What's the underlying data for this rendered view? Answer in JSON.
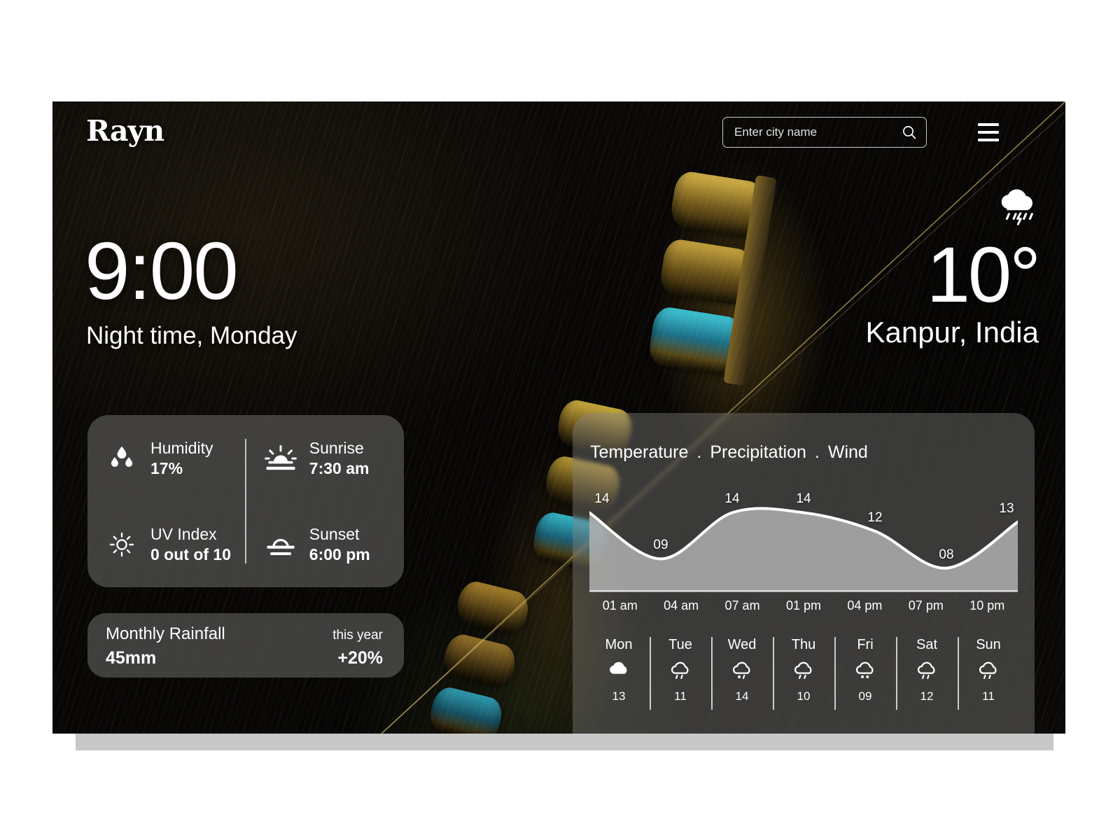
{
  "app": {
    "logo": "Rayn"
  },
  "topbar": {
    "search_placeholder": "Enter city name",
    "search_value": "",
    "search_icon": "search-icon",
    "menu_icon": "hamburger-menu-icon"
  },
  "hero": {
    "time": "9:00",
    "subtitle": "Night time, Monday",
    "temperature": "10°",
    "location": "Kanpur, India",
    "condition_icon": "thunderstorm-rain-cloud-icon"
  },
  "stats": {
    "humidity": {
      "label": "Humidity",
      "value": "17%",
      "icon": "water-drops-icon"
    },
    "uv_index": {
      "label": "UV Index",
      "value": "0 out of 10",
      "icon": "sun-icon"
    },
    "sunrise": {
      "label": "Sunrise",
      "value": "7:30 am",
      "icon": "sunrise-icon"
    },
    "sunset": {
      "label": "Sunset",
      "value": "6:00 pm",
      "icon": "sunset-icon"
    }
  },
  "rainfall": {
    "title": "Monthly Rainfall",
    "value": "45mm",
    "note": "this year",
    "delta": "+20%"
  },
  "forecast": {
    "tabs": [
      {
        "label": "Temperature",
        "active": true
      },
      {
        "label": "Precipitation",
        "active": false
      },
      {
        "label": "Wind",
        "active": false
      }
    ],
    "tab_separator": ".",
    "days": [
      {
        "name": "Mon",
        "temp": "13",
        "icon": "cloud-icon"
      },
      {
        "name": "Tue",
        "temp": "11",
        "icon": "cloud-rain-icon"
      },
      {
        "name": "Wed",
        "temp": "14",
        "icon": "cloud-sleet-icon"
      },
      {
        "name": "Thu",
        "temp": "10",
        "icon": "cloud-rain-icon"
      },
      {
        "name": "Fri",
        "temp": "09",
        "icon": "cloud-snow-icon"
      },
      {
        "name": "Sat",
        "temp": "12",
        "icon": "cloud-rain-icon"
      },
      {
        "name": "Sun",
        "temp": "11",
        "icon": "cloud-rain-icon"
      }
    ]
  },
  "chart_data": {
    "type": "area",
    "title": "Temperature",
    "xlabel": "",
    "ylabel": "",
    "categories": [
      "01 am",
      "04 am",
      "07 am",
      "01 pm",
      "04 pm",
      "07 pm",
      "10 pm"
    ],
    "values": [
      14,
      9,
      14,
      14,
      12,
      8,
      13
    ],
    "point_labels": [
      "14",
      "09",
      "14",
      "14",
      "12",
      "08",
      "13"
    ],
    "ylim": [
      6,
      16
    ],
    "grid": false,
    "legend": false,
    "line_color": "#ffffff",
    "fill_color": "#b0b0b0"
  },
  "colors": {
    "card_bg": "#8c8c8a",
    "text": "#ffffff",
    "frame": "#c8c8c8",
    "page_bg": "#ffffff"
  }
}
